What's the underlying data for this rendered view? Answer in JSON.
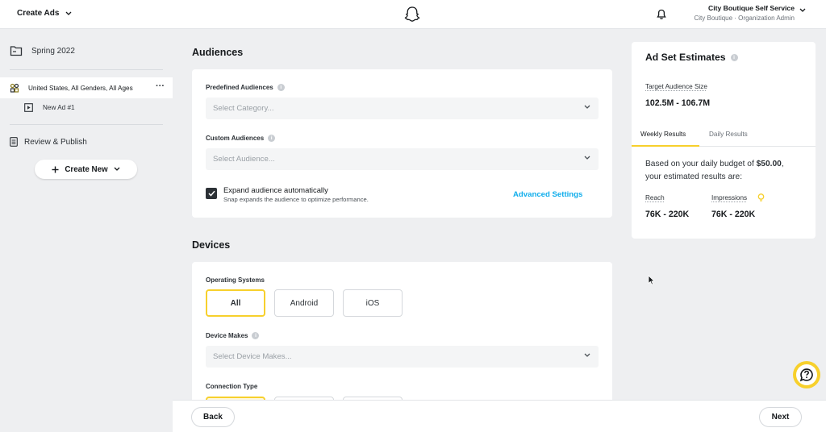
{
  "header": {
    "title": "Create Ads",
    "org_name": "City Boutique Self Service",
    "org_role": "City Boutique · Organization Admin"
  },
  "sidebar": {
    "campaign": "Spring 2022",
    "ad_set": "United States, All Genders, All Ages",
    "ad_set_menu": "···",
    "ad": "New Ad #1",
    "review": "Review & Publish",
    "create_new": "Create New"
  },
  "audiences": {
    "title": "Audiences",
    "predefined_label": "Predefined Audiences",
    "predefined_placeholder": "Select Category...",
    "custom_label": "Custom Audiences",
    "custom_placeholder": "Select Audience...",
    "expand_label": "Expand audience automatically",
    "expand_sub": "Snap expands the audience to optimize performance.",
    "expand_checked": true,
    "advanced_settings": "Advanced Settings"
  },
  "devices": {
    "title": "Devices",
    "os_label": "Operating Systems",
    "os_options": [
      "All",
      "Android",
      "iOS"
    ],
    "os_selected": "All",
    "makes_label": "Device Makes",
    "makes_placeholder": "Select Device Makes...",
    "connection_label": "Connection Type"
  },
  "estimates": {
    "title": "Ad Set Estimates",
    "audience_size_label": "Target Audience Size",
    "audience_size_value": "102.5M - 106.7M",
    "tabs": [
      "Weekly Results",
      "Daily Results"
    ],
    "active_tab": "Weekly Results",
    "budget_text_1": "Based on your daily budget of ",
    "budget_amount": "$50.00",
    "budget_text_2": ",",
    "budget_text_3": "your estimated results are:",
    "reach_label": "Reach",
    "reach_value": "76K - 220K",
    "impressions_label": "Impressions",
    "impressions_value": "76K - 220K"
  },
  "footer": {
    "back": "Back",
    "next": "Next"
  },
  "colors": {
    "accent_yellow": "#f7d02c",
    "link_blue": "#0fadeb",
    "sidebar_bg": "#eeeff1"
  }
}
